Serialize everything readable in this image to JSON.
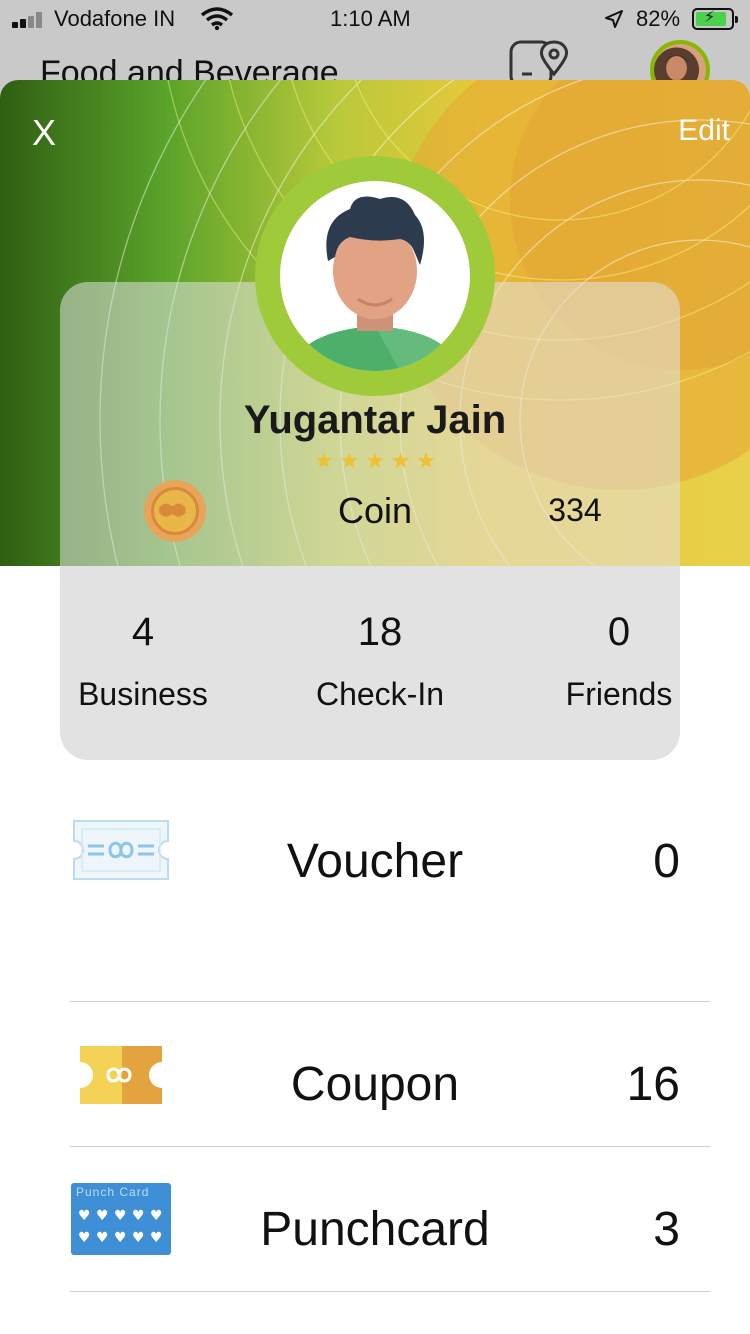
{
  "status_bar": {
    "carrier": "Vodafone IN",
    "time": "1:10 AM",
    "battery": "82%"
  },
  "background_header": {
    "title": "Food and Beverage"
  },
  "profile_sheet": {
    "close_label": "X",
    "edit_label": "Edit",
    "user_name": "Yugantar Jain",
    "rating_stars": 5,
    "coin": {
      "label": "Coin",
      "value": "334"
    },
    "stats": [
      {
        "value": "4",
        "label": "Business"
      },
      {
        "value": "18",
        "label": "Check-In"
      },
      {
        "value": "0",
        "label": "Friends"
      }
    ],
    "wallet_items": [
      {
        "label": "Voucher",
        "value": "0",
        "icon": "voucher-icon"
      },
      {
        "label": "Coupon",
        "value": "16",
        "icon": "coupon-icon"
      },
      {
        "label": "Punchcard",
        "value": "3",
        "icon": "punchcard-icon"
      }
    ],
    "punchcard_icon_text": "Punch Card"
  },
  "colors": {
    "accent_green": "#9fcb3a",
    "hero_yellow": "#e9c93a",
    "coupon_yellow": "#f0c040"
  }
}
